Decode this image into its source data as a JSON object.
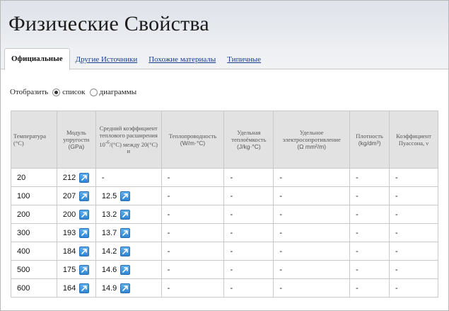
{
  "page": {
    "title": "Физические Свойства"
  },
  "tabs": [
    {
      "label": "Официальные",
      "active": true
    },
    {
      "label": "Другие Источники",
      "active": false
    },
    {
      "label": "Похожие материалы",
      "active": false
    },
    {
      "label": "Типичные",
      "active": false
    }
  ],
  "display": {
    "label": "Отобразить",
    "options": [
      {
        "label": "список",
        "selected": true
      },
      {
        "label": "диаграммы",
        "selected": false
      }
    ]
  },
  "table": {
    "headers": {
      "temp": "Температура (°C)",
      "modulus_1": "Модуль упругости",
      "modulus_2": "(GPa)",
      "cte_1": "Средний коэффициент теплового расширения 10",
      "cte_sup": "-6",
      "cte_2": "/(°C) между 20(°C) и",
      "conductivity_1": "Теплопроводность",
      "conductivity_2": "(W/m·°C)",
      "heat_1": "Удельная теплоёмкость",
      "heat_2": "(J/kg·°C)",
      "resistivity_1": "Удельное электросопротивление",
      "resistivity_2": "(Ω mm²/m)",
      "density_1": "Плотность",
      "density_2": "(kg/dm³)",
      "poisson": "Коэффициент Пуассона, ν"
    },
    "rows": [
      {
        "temp": "20",
        "modulus": "212",
        "cte": "-",
        "conductivity": "-",
        "heat": "-",
        "resistivity": "-",
        "density": "-",
        "poisson": "-"
      },
      {
        "temp": "100",
        "modulus": "207",
        "cte": "12.5",
        "conductivity": "-",
        "heat": "-",
        "resistivity": "-",
        "density": "-",
        "poisson": "-"
      },
      {
        "temp": "200",
        "modulus": "200",
        "cte": "13.2",
        "conductivity": "-",
        "heat": "-",
        "resistivity": "-",
        "density": "-",
        "poisson": "-"
      },
      {
        "temp": "300",
        "modulus": "193",
        "cte": "13.7",
        "conductivity": "-",
        "heat": "-",
        "resistivity": "-",
        "density": "-",
        "poisson": "-"
      },
      {
        "temp": "400",
        "modulus": "184",
        "cte": "14.2",
        "conductivity": "-",
        "heat": "-",
        "resistivity": "-",
        "density": "-",
        "poisson": "-"
      },
      {
        "temp": "500",
        "modulus": "175",
        "cte": "14.6",
        "conductivity": "-",
        "heat": "-",
        "resistivity": "-",
        "density": "-",
        "poisson": "-"
      },
      {
        "temp": "600",
        "modulus": "164",
        "cte": "14.9",
        "conductivity": "-",
        "heat": "-",
        "resistivity": "-",
        "density": "-",
        "poisson": "-"
      }
    ]
  },
  "icons": {
    "chart_link": "chart-link-icon"
  },
  "colors": {
    "link": "#1a3e8f",
    "header_bg": "#e2e2e2",
    "icon_blue": "#3a94df"
  }
}
